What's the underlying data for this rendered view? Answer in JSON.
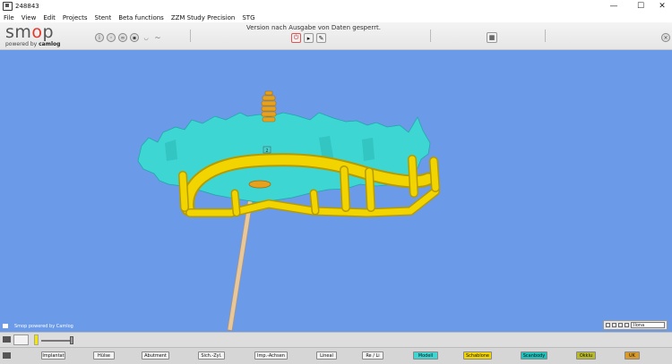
{
  "window": {
    "title": "248843",
    "minimize": "—",
    "maximize": "☐",
    "close": "✕"
  },
  "menu": [
    "File",
    "View",
    "Edit",
    "Projects",
    "Stent",
    "Beta functions",
    "ZZM Study Precision",
    "STG"
  ],
  "logo": {
    "brand_prefix": "sm",
    "brand_o": "o",
    "brand_suffix": "p",
    "tagline_prefix": "powered by ",
    "tagline_brand": "camlog"
  },
  "toolbar": {
    "status_message": "Version nach Ausgabe von Daten gesperrt."
  },
  "viewport": {
    "caption": "Smop powered by Camlog",
    "view_select": "Ilona",
    "implant_marker": "2"
  },
  "colors": {
    "background": "#6a9ae8",
    "model": "#3dd6d2",
    "template": "#f2d400",
    "implant": "#e6a21f",
    "pin": "#e8c79a"
  },
  "labels": {
    "implantat": "Implantat",
    "huelse": "Hülse",
    "abutment": "Abutment",
    "sich_zyl": "Sich.-Zyl.",
    "imp_achsen": "Imp.-Achsen",
    "lineal": "Lineal",
    "re_li": "Re / Li",
    "modell": "Modell",
    "schablone": "Schablone",
    "scanbody": "Scanbody",
    "okklu": "Okklu",
    "uk": "UK"
  }
}
